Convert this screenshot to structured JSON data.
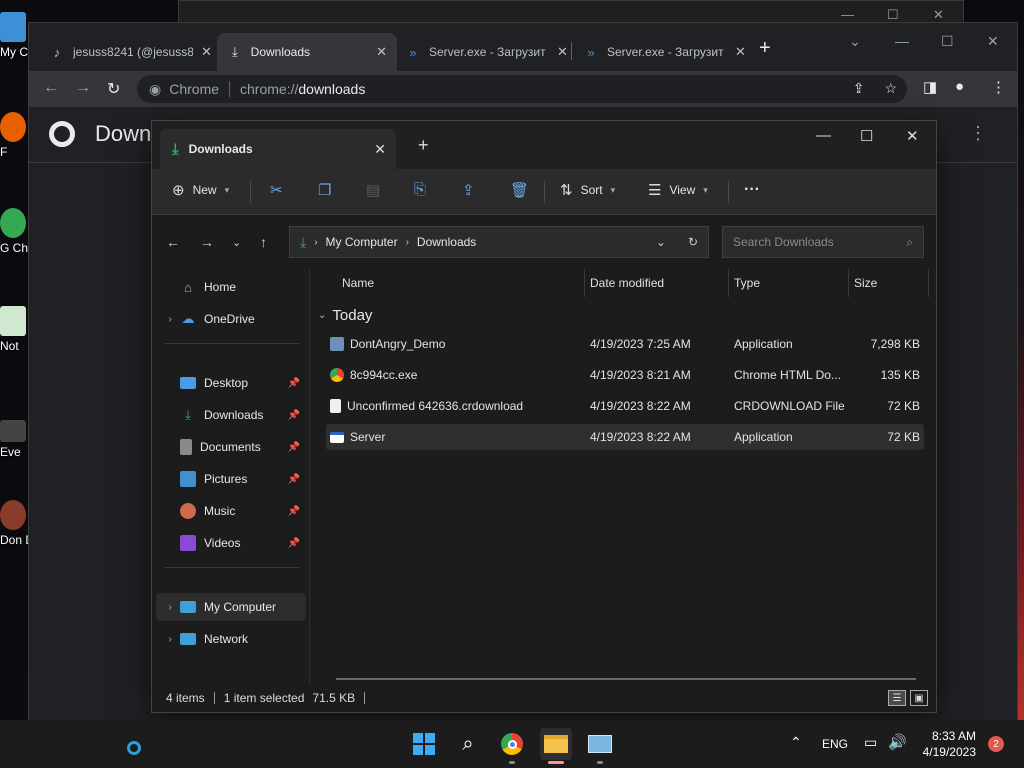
{
  "desktop": {
    "icons": [
      {
        "label": "My C",
        "icon": "computer-icon",
        "color": "#3d8fd6"
      },
      {
        "label": "F",
        "icon": "firefox-icon",
        "color": "#e66000"
      },
      {
        "label": "G\nCh",
        "icon": "chrome-icon",
        "color": "#34a853"
      },
      {
        "label": "Not",
        "icon": "notepad-icon",
        "color": "#cfe8cf"
      },
      {
        "label": "Eve",
        "icon": "shortcut-icon",
        "color": "#444"
      },
      {
        "label": "Don\nD",
        "icon": "game-icon",
        "color": "#8a3b2a"
      }
    ]
  },
  "chrome": {
    "tabs": [
      {
        "title": "jesuss8241 (@jesuss8",
        "icon": "tiktok-icon",
        "close": "✕"
      },
      {
        "title": "Downloads",
        "icon": "download-icon",
        "close": "✕"
      },
      {
        "title": "Server.exe - Загрузит",
        "icon": "chevron-icon",
        "close": "✕"
      },
      {
        "title": "Server.exe - Загрузит",
        "icon": "chevron-icon",
        "close": "✕"
      }
    ],
    "new_tab": "+",
    "omnibox_chip": "Chrome",
    "url_scheme": "chrome://",
    "url_path": "downloads",
    "page_title": "Downloads"
  },
  "explorer": {
    "tab_title": "Downloads",
    "new_tab": "+",
    "commands": {
      "new": "New",
      "sort": "Sort",
      "view": "View",
      "more": "···"
    },
    "address": {
      "crumbs": [
        "My Computer",
        "Downloads"
      ]
    },
    "search_placeholder": "Search Downloads",
    "sidebar": [
      {
        "label": "Home",
        "icon": "home-icon",
        "pinned": false,
        "expandable": false
      },
      {
        "label": "OneDrive",
        "icon": "cloud-icon",
        "pinned": false,
        "expandable": true
      },
      {
        "label": "Desktop",
        "icon": "desktop-icon",
        "pinned": true,
        "expandable": false
      },
      {
        "label": "Downloads",
        "icon": "download-icon",
        "pinned": true,
        "expandable": false
      },
      {
        "label": "Documents",
        "icon": "document-icon",
        "pinned": true,
        "expandable": false
      },
      {
        "label": "Pictures",
        "icon": "picture-icon",
        "pinned": true,
        "expandable": false
      },
      {
        "label": "Music",
        "icon": "music-icon",
        "pinned": true,
        "expandable": false
      },
      {
        "label": "Videos",
        "icon": "video-icon",
        "pinned": true,
        "expandable": false
      },
      {
        "label": "My Computer",
        "icon": "computer-icon",
        "pinned": false,
        "expandable": true,
        "selected": true
      },
      {
        "label": "Network",
        "icon": "network-icon",
        "pinned": false,
        "expandable": true
      }
    ],
    "columns": {
      "name": "Name",
      "date": "Date modified",
      "type": "Type",
      "size": "Size"
    },
    "group": "Today",
    "files": [
      {
        "name": "DontAngry_Demo",
        "date": "4/19/2023 7:25 AM",
        "type": "Application",
        "size": "7,298 KB",
        "icon": "app-icon",
        "selected": false
      },
      {
        "name": "8c994cc.exe",
        "date": "4/19/2023 8:21 AM",
        "type": "Chrome HTML Do...",
        "size": "135 KB",
        "icon": "chrome-icon",
        "selected": false
      },
      {
        "name": "Unconfirmed 642636.crdownload",
        "date": "4/19/2023 8:22 AM",
        "type": "CRDOWNLOAD File",
        "size": "72 KB",
        "icon": "file-icon",
        "selected": false
      },
      {
        "name": "Server",
        "date": "4/19/2023 8:22 AM",
        "type": "Application",
        "size": "72 KB",
        "icon": "app-window-icon",
        "selected": true
      }
    ],
    "status": {
      "items": "4 items",
      "selected": "1 item selected",
      "size": "71.5 KB"
    }
  },
  "taskbar": {
    "lang": "ENG",
    "time": "8:33 AM",
    "date": "4/19/2023",
    "notifications": "2"
  }
}
